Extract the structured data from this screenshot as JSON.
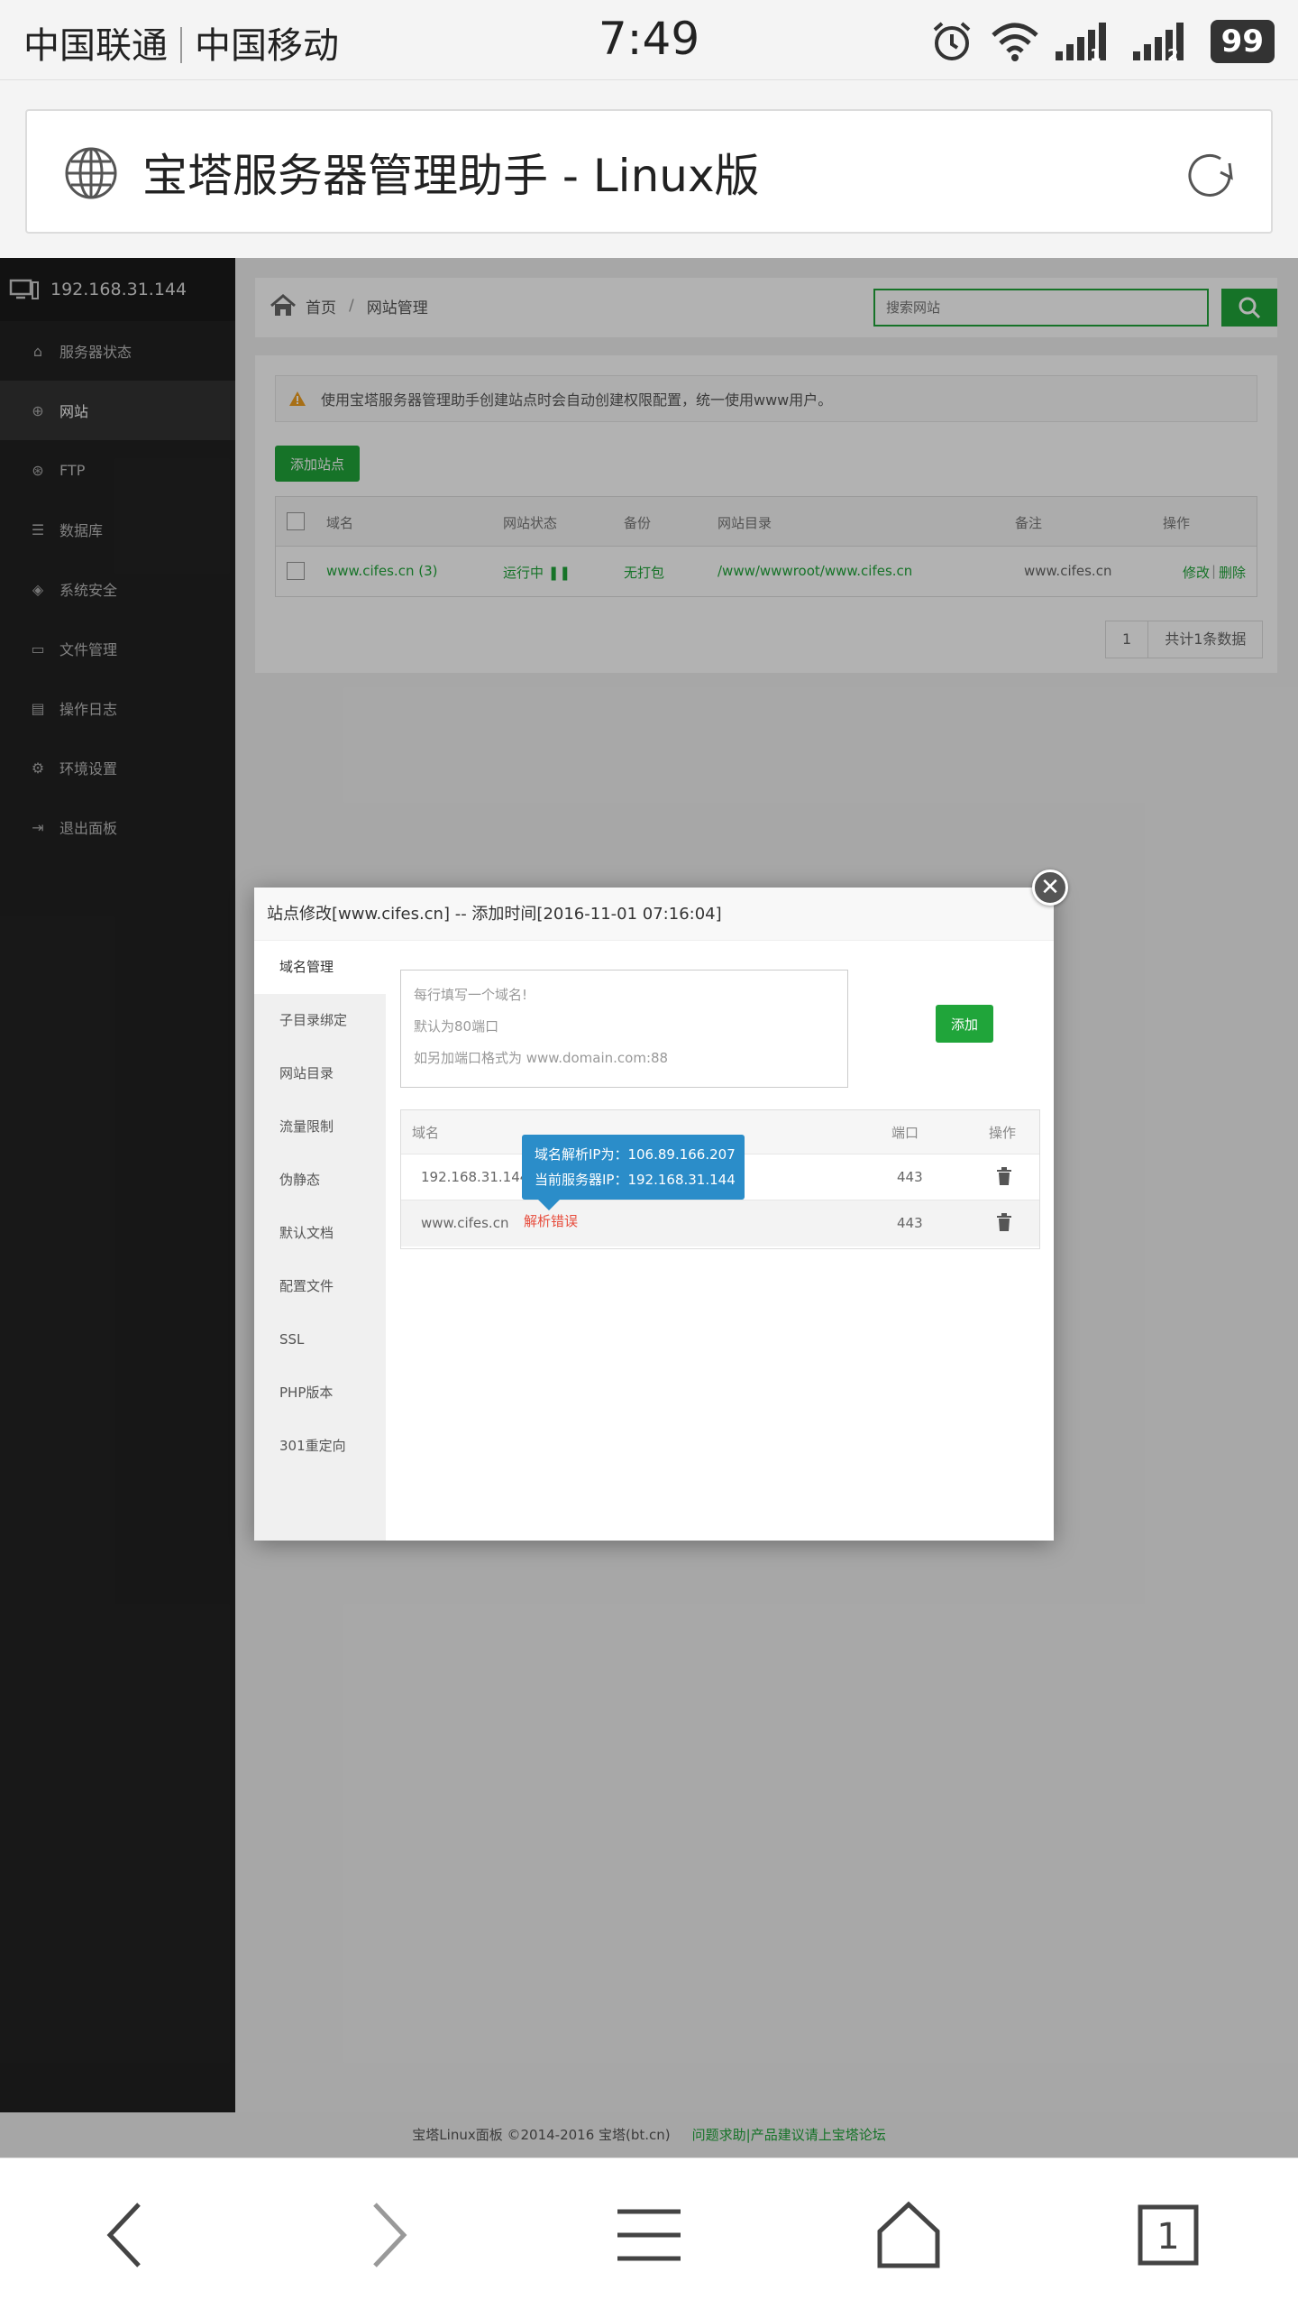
{
  "status_bar": {
    "carrier1": "中国联通",
    "carrier2": "中国移动",
    "time": "7:49",
    "battery": "99",
    "sim1": "1",
    "sim2": "2"
  },
  "browser": {
    "page_title": "宝塔服务器管理助手 - Linux版",
    "tab_count": "1"
  },
  "sidebar": {
    "server_ip": "192.168.31.144",
    "items": [
      {
        "label": "服务器状态",
        "icon": "home-icon"
      },
      {
        "label": "网站",
        "icon": "globe-icon"
      },
      {
        "label": "FTP",
        "icon": "ftp-icon"
      },
      {
        "label": "数据库",
        "icon": "database-icon"
      },
      {
        "label": "系统安全",
        "icon": "shield-icon"
      },
      {
        "label": "文件管理",
        "icon": "folder-icon"
      },
      {
        "label": "操作日志",
        "icon": "log-icon"
      },
      {
        "label": "环境设置",
        "icon": "gear-icon"
      },
      {
        "label": "退出面板",
        "icon": "logout-icon"
      }
    ]
  },
  "breadcrumb": {
    "home": "首页",
    "separator": "/",
    "current": "网站管理"
  },
  "search": {
    "placeholder": "搜索网站"
  },
  "site_panel": {
    "notice": "使用宝塔服务器管理助手创建站点时会自动创建权限配置，统一使用www用户。",
    "add_button": "添加站点",
    "columns": [
      "域名",
      "网站状态",
      "备份",
      "网站目录",
      "备注",
      "操作"
    ],
    "rows": [
      {
        "domain": "www.cifes.cn (3)",
        "status": "运行中",
        "backup": "无打包",
        "dir": "/www/wwwroot/www.cifes.cn",
        "remark": "www.cifes.cn",
        "edit": "修改",
        "action_sep": "|",
        "delete": "删除"
      }
    ],
    "pager": {
      "page": "1",
      "total": "共计1条数据"
    }
  },
  "modal": {
    "title": "站点修改[www.cifes.cn] -- 添加时间[2016-11-01 07:16:04]",
    "tabs": [
      "域名管理",
      "子目录绑定",
      "网站目录",
      "流量限制",
      "伪静态",
      "默认文档",
      "配置文件",
      "SSL",
      "PHP版本",
      "301重定向"
    ],
    "textarea_lines": [
      "每行填写一个域名!",
      "默认为80端口",
      "如另加端口格式为 www.domain.com:88"
    ],
    "add_button": "添加",
    "columns": [
      "域名",
      "端口",
      "操作"
    ],
    "rows": [
      {
        "domain": "192.168.31.144",
        "port": "443"
      },
      {
        "domain": "www.cifes.cn",
        "port": "443",
        "error": "解析错误"
      }
    ],
    "tooltip": {
      "line1": "域名解析IP为：106.89.166.207",
      "line2": "当前服务器IP：192.168.31.144"
    }
  },
  "footer": {
    "copyright": "宝塔Linux面板 ©2014-2016 宝塔(bt.cn)",
    "link": "问题求助|产品建议请上宝塔论坛"
  },
  "colors": {
    "accent": "#20a53a",
    "sidebar": "#222222",
    "tooltip": "#2b8dc9",
    "error": "#e74c3c"
  }
}
